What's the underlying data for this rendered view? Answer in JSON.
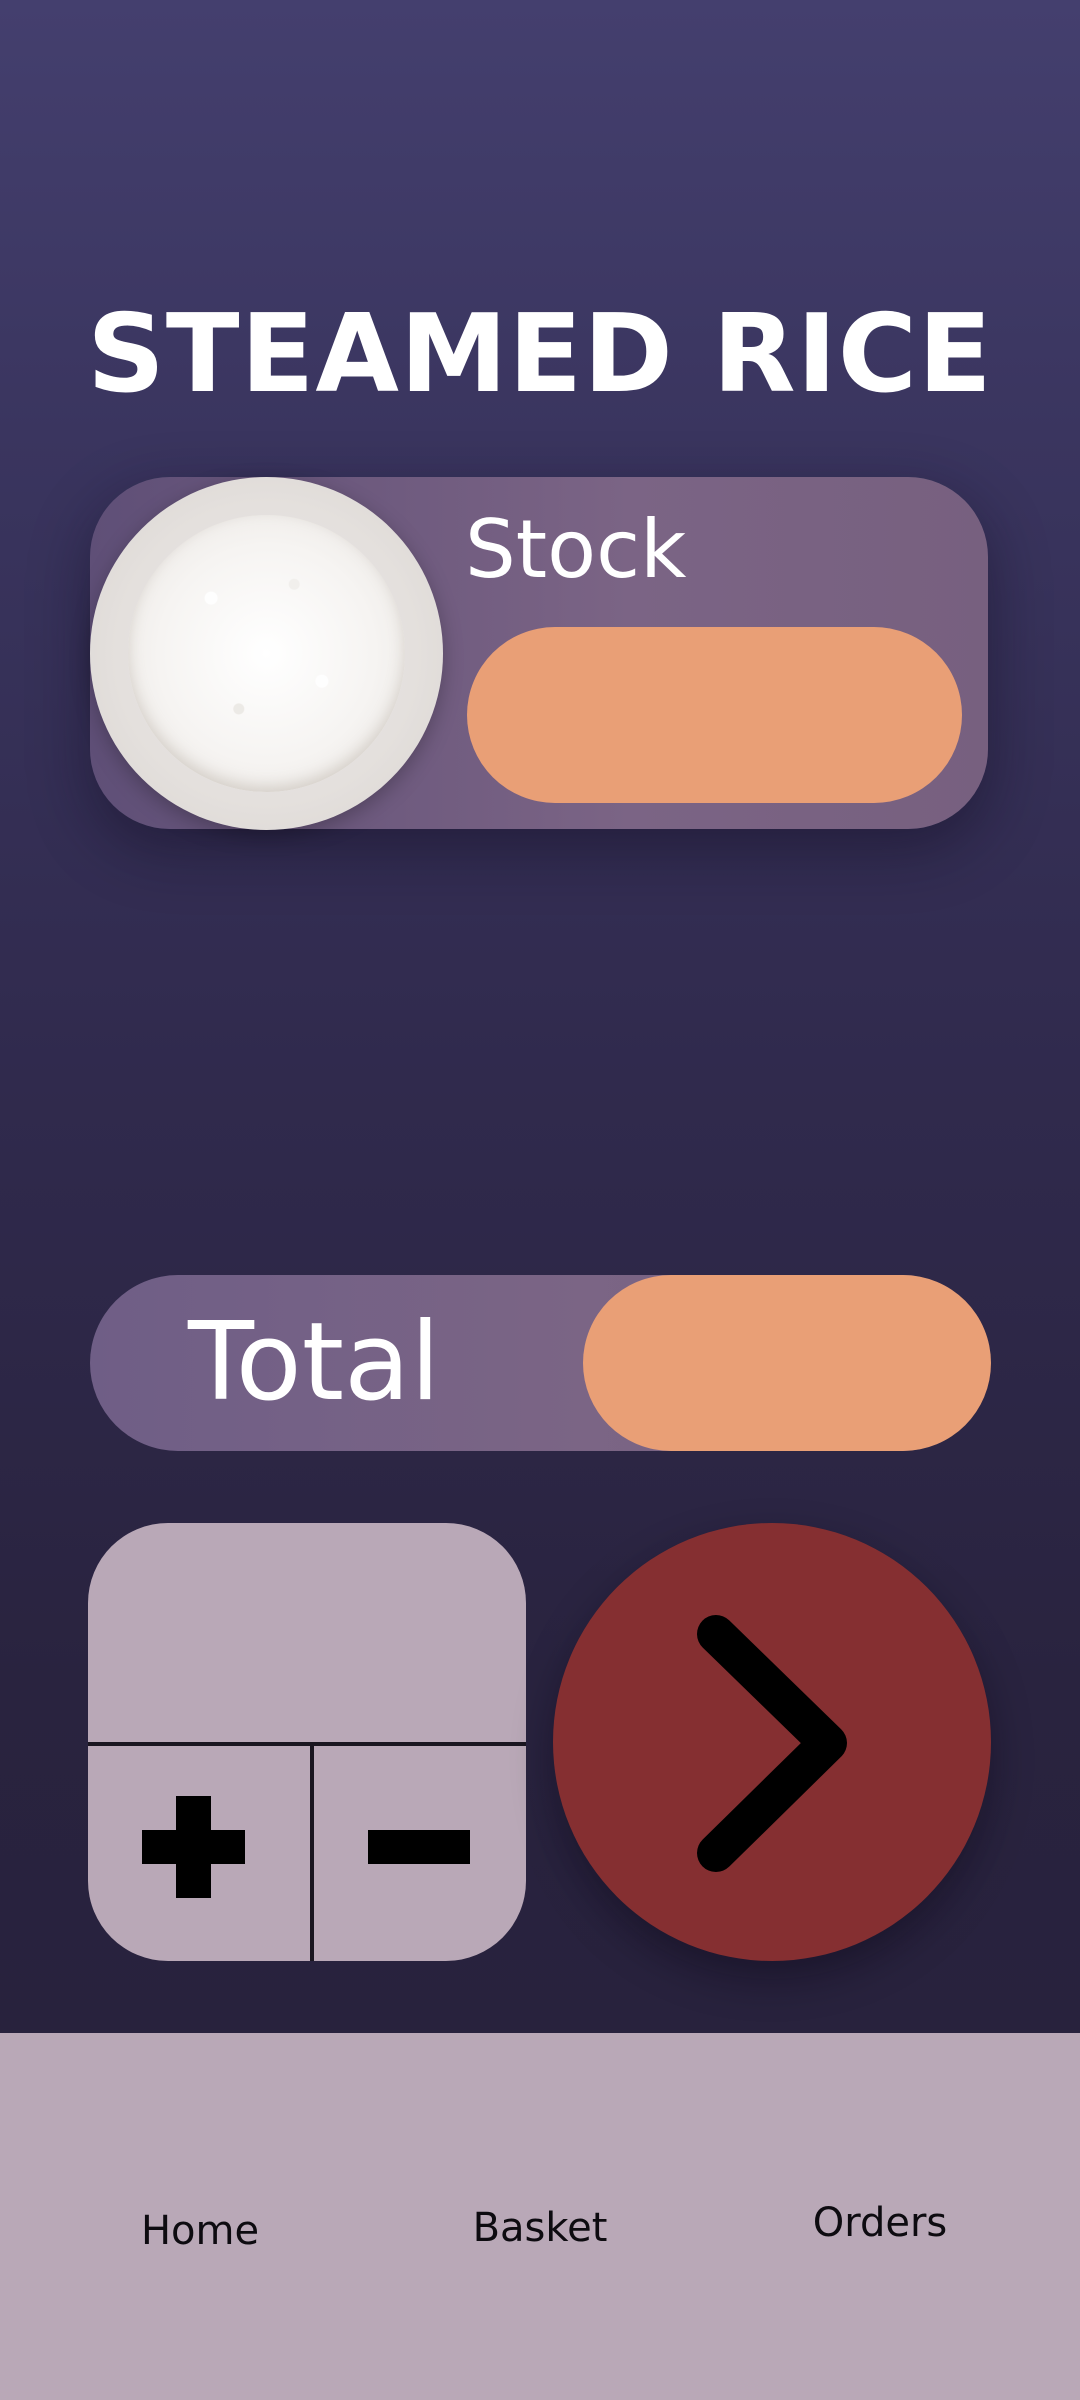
{
  "header": {
    "title": "STEAMED RICE"
  },
  "product": {
    "image_icon": "rice-bowl-image",
    "stock_label": "Stock",
    "stock_value": ""
  },
  "order": {
    "total_label": "Total",
    "total_value": "",
    "quantity_value": "",
    "plus_icon": "plus-icon",
    "minus_icon": "minus-icon",
    "next_icon": "chevron-right-icon"
  },
  "colors": {
    "accent_pill": "#e99f76",
    "next_button": "#852f31",
    "panel": "#b9a8b7",
    "card": "#7b6485"
  },
  "nav": {
    "items": [
      {
        "label": "Home"
      },
      {
        "label": "Basket"
      },
      {
        "label": "Orders"
      }
    ]
  }
}
